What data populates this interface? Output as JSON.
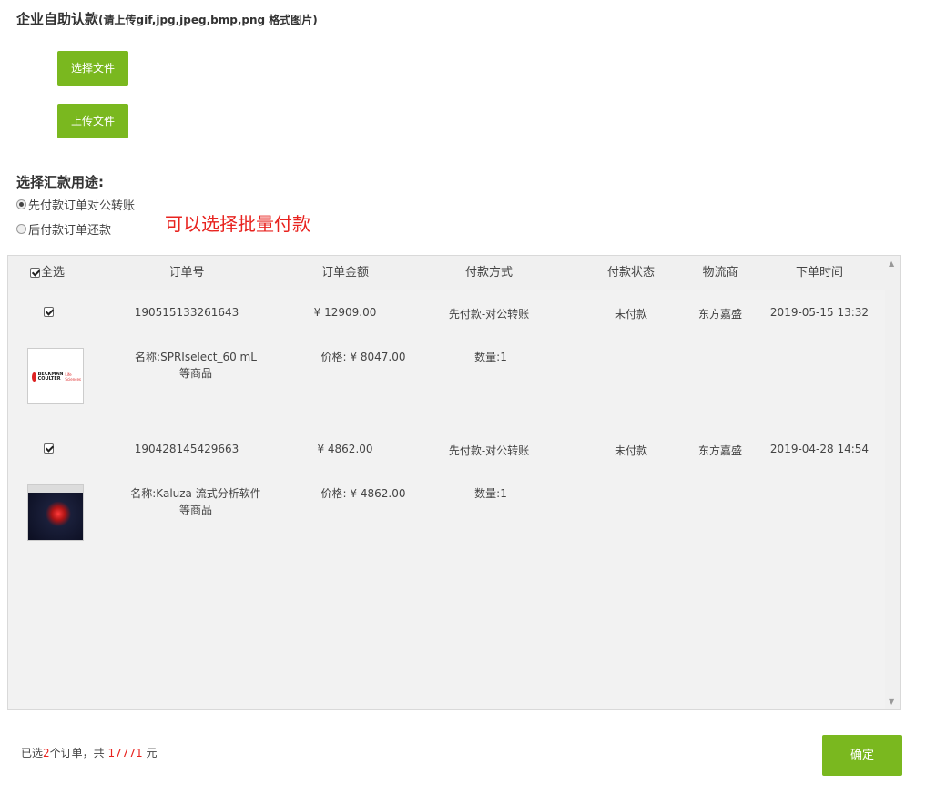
{
  "upload": {
    "title": "企业自助认款",
    "hint": "(请上传gif,jpg,jpeg,bmp,png 格式图片)",
    "choose_file_label": "选择文件",
    "upload_file_label": "上传文件"
  },
  "purpose": {
    "label": "选择汇款用途:",
    "options": [
      {
        "label": "先付款订单对公转账",
        "selected": true
      },
      {
        "label": "后付款订单还款",
        "selected": false
      }
    ],
    "annotation": "可以选择批量付款"
  },
  "table": {
    "select_all_label": "全选",
    "columns": [
      "订单号",
      "订单金额",
      "付款方式",
      "付款状态",
      "物流商",
      "下单时间"
    ],
    "orders": [
      {
        "checked": true,
        "order_no": "190515133261643",
        "amount": "¥ 12909.00",
        "pay_method": "先付款-对公转账",
        "pay_status": "未付款",
        "logistics": "东方嘉盛",
        "order_time": "2019-05-15 13:32",
        "product": {
          "name": "名称:SPRIselect_60 mL",
          "more": "等商品",
          "price": "价格: ¥ 8047.00",
          "qty": "数量:1",
          "thumb": "beckman-coulter-logo",
          "logo_text": [
            "BECKMAN",
            "COULTER"
          ],
          "logo_sub": "Life Sciences"
        }
      },
      {
        "checked": true,
        "order_no": "190428145429663",
        "amount": "¥ 4862.00",
        "pay_method": "先付款-对公转账",
        "pay_status": "未付款",
        "logistics": "东方嘉盛",
        "order_time": "2019-04-28 14:54",
        "product": {
          "name": "名称:Kaluza 流式分析软件",
          "more": "等商品",
          "price": "价格: ¥ 4862.00",
          "qty": "数量:1",
          "thumb": "software-box-photo"
        }
      }
    ]
  },
  "footer": {
    "prefix": "已选",
    "count": "2",
    "middle": "个订单，共 ",
    "total": "17771",
    "suffix": " 元",
    "confirm_label": "确定"
  },
  "colors": {
    "accent_green": "#7ab81f",
    "highlight_red": "#e8231f"
  }
}
